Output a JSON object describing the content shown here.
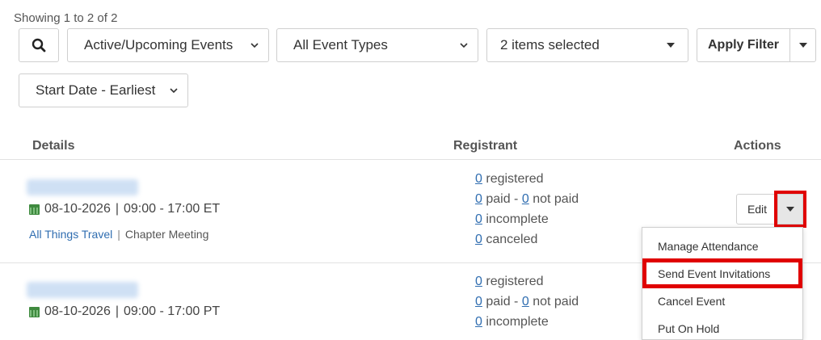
{
  "summary": "Showing 1 to 2 of 2",
  "filters": {
    "status": "Active/Upcoming Events",
    "types": "All Event Types",
    "multi": "2 items selected",
    "apply": "Apply Filter",
    "sort": "Start Date - Earliest"
  },
  "table": {
    "headers": {
      "details": "Details",
      "registrant": "Registrant",
      "actions": "Actions"
    },
    "rows": [
      {
        "date": "08-10-2026",
        "time": "09:00 - 17:00 ET",
        "category": "All Things Travel",
        "type": "Chapter Meeting",
        "registered_count": "0",
        "registered_label": "registered",
        "paid_count": "0",
        "paid_label": "paid -",
        "not_paid_count": "0",
        "not_paid_label": "not paid",
        "incomplete_count": "0",
        "incomplete_label": "incomplete",
        "canceled_count": "0",
        "canceled_label": "canceled"
      },
      {
        "date": "08-10-2026",
        "time": "09:00 - 17:00 PT",
        "registered_count": "0",
        "registered_label": "registered",
        "paid_count": "0",
        "paid_label": "paid -",
        "not_paid_count": "0",
        "not_paid_label": "not paid",
        "incomplete_count": "0",
        "incomplete_label": "incomplete"
      }
    ]
  },
  "actions": {
    "edit": "Edit",
    "menu": [
      "Manage Attendance",
      "Send Event Invitations",
      "Cancel Event",
      "Put On Hold"
    ]
  },
  "colors": {
    "link": "#2f6db0",
    "highlight": "#e00000",
    "calendar": "#3f8a3f"
  },
  "icons": {
    "search": "search-icon",
    "calendar": "calendar-icon",
    "caret": "caret-down-icon",
    "chevron": "chevron-down-icon"
  }
}
